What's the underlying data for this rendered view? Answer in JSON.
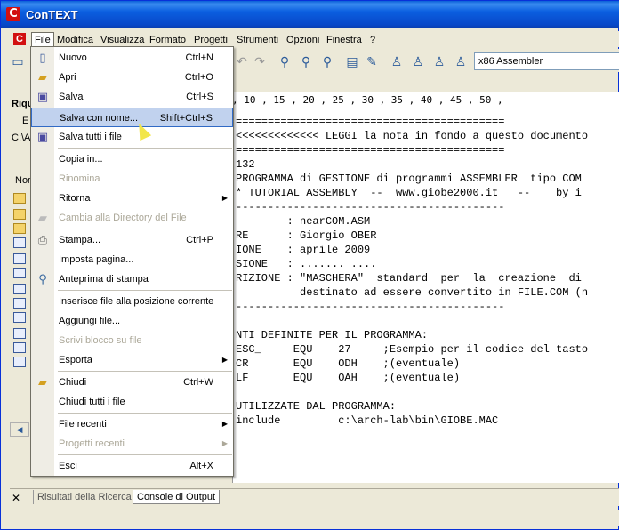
{
  "window": {
    "title": "ConTEXT",
    "logo": "C"
  },
  "menubar": {
    "items": [
      "File",
      "Modifica",
      "Visualizza",
      "Formato",
      "Progetti",
      "Strumenti",
      "Opzioni",
      "Finestra",
      "?"
    ]
  },
  "toolbar": {
    "language": "x86 Assembler"
  },
  "left_panel": {
    "header": "Riqu",
    "tab_letter": "E",
    "path": "C:\\A",
    "column": "Nor"
  },
  "ruler": ", 10 , 15 , 20 , 25 , 30 , 35 , 40 , 45 , 50 ,",
  "code": [
    "==========================================",
    "<<<<<<<<<<<<< LEGGI la nota in fondo a questo documento",
    "==========================================",
    "132",
    "PROGRAMMA di GESTIONE di programmi ASSEMBLER  tipo COM",
    "* TUTORIAL ASSEMBLY  --  www.giobe2000.it   --    by i",
    "------------------------------------------",
    "        : nearCOM.ASM",
    "RE      : Giorgio OBER",
    "IONE    : aprile 2009",
    "SIONE   : ....... ....",
    "RIZIONE : \"MASCHERA\"  standard  per  la  creazione  di",
    "          destinato ad essere convertito in FILE.COM (n",
    "------------------------------------------",
    "",
    "NTI DEFINITE PER IL PROGRAMMA:",
    "ESC_     EQU    27     ;Esempio per il codice del tasto",
    "CR       EQU    ODH    ;(eventuale)",
    "LF       EQU    OAH    ;(eventuale)",
    "",
    "UTILIZZATE DAL PROGRAMMA:",
    "include         c:\\arch-lab\\bin\\GIOBE.MAC"
  ],
  "file_menu": {
    "items": [
      {
        "label": "Nuovo",
        "shortcut": "Ctrl+N",
        "icon": "new-file-icon"
      },
      {
        "label": "Apri",
        "shortcut": "Ctrl+O",
        "icon": "open-folder-icon"
      },
      {
        "label": "Salva",
        "shortcut": "Ctrl+S",
        "icon": "save-icon"
      },
      {
        "label": "Salva con nome...",
        "shortcut": "Shift+Ctrl+S",
        "highlighted": true
      },
      {
        "label": "Salva tutti i file",
        "icon": "save-all-icon"
      },
      {
        "label": "Copia in..."
      },
      {
        "label": "Rinomina",
        "disabled": true
      },
      {
        "label": "Ritorna",
        "submenu": true
      },
      {
        "label": "Cambia alla Directory del File",
        "disabled": true,
        "icon": "folder-icon"
      },
      {
        "label": "Stampa...",
        "shortcut": "Ctrl+P",
        "icon": "printer-icon"
      },
      {
        "label": "Imposta pagina..."
      },
      {
        "label": "Anteprima di stampa",
        "icon": "print-preview-icon"
      },
      {
        "label": "Inserisce file alla posizione corrente"
      },
      {
        "label": "Aggiungi file..."
      },
      {
        "label": "Scrivi blocco su file",
        "disabled": true
      },
      {
        "label": "Esporta",
        "submenu": true
      },
      {
        "label": "Chiudi",
        "shortcut": "Ctrl+W",
        "icon": "close-folder-icon"
      },
      {
        "label": "Chiudi tutti i file"
      },
      {
        "label": "File recenti",
        "submenu": true
      },
      {
        "label": "Progetti recenti",
        "submenu": true,
        "disabled": true
      },
      {
        "label": "Esci",
        "shortcut": "Alt+X"
      }
    ]
  },
  "bottom_tabs": {
    "close": "✕",
    "search": "Risultati della Ricerca",
    "console": "Console di Output"
  }
}
